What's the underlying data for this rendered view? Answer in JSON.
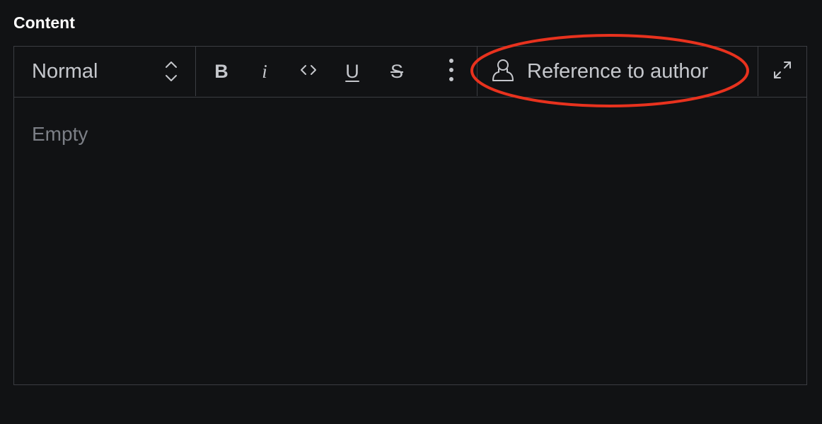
{
  "field": {
    "label": "Content"
  },
  "toolbar": {
    "style_select": {
      "value": "Normal",
      "icon": "chevron-up-down-icon"
    },
    "format_buttons": [
      {
        "name": "bold",
        "glyph": "B",
        "icon": "bold-icon"
      },
      {
        "name": "italic",
        "glyph": "i",
        "icon": "italic-icon"
      },
      {
        "name": "code",
        "glyph": "<>",
        "icon": "code-icon"
      },
      {
        "name": "underline",
        "glyph": "U",
        "icon": "underline-icon"
      },
      {
        "name": "strikethrough",
        "glyph": "S",
        "icon": "strikethrough-icon"
      },
      {
        "name": "more",
        "icon": "more-vertical-icon"
      }
    ],
    "reference_button": {
      "label": "Reference to author",
      "icon": "user-icon"
    },
    "expand_button": {
      "icon": "expand-icon"
    }
  },
  "editor": {
    "placeholder": "Empty"
  },
  "colors": {
    "background": "#111214",
    "border": "#3b3d42",
    "text": "#c5c7cc",
    "placeholder": "#7c7f86",
    "annotation": "#e8321e"
  }
}
